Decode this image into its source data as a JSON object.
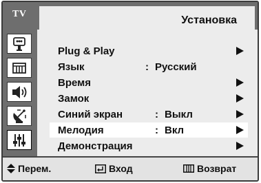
{
  "header": {
    "tv_label": "TV",
    "title": "Установка"
  },
  "sidebar": {
    "icons": [
      {
        "name": "picture-icon",
        "active": false
      },
      {
        "name": "channel-list-icon",
        "active": false
      },
      {
        "name": "sound-icon",
        "active": false
      },
      {
        "name": "antenna-icon",
        "active": false
      },
      {
        "name": "setup-sliders-icon",
        "active": true
      }
    ]
  },
  "menu": {
    "items": [
      {
        "label": "Plug & Play",
        "value": "",
        "has_arrow": true,
        "selected": false
      },
      {
        "label": "Язык",
        "value": "Русский",
        "has_arrow": false,
        "selected": false
      },
      {
        "label": "Время",
        "value": "",
        "has_arrow": true,
        "selected": false
      },
      {
        "label": "Замок",
        "value": "",
        "has_arrow": true,
        "selected": false
      },
      {
        "label": "Синий экран",
        "value": "Выкл",
        "has_arrow": true,
        "selected": false
      },
      {
        "label": "Мелодия",
        "value": "Вкл",
        "has_arrow": true,
        "selected": true
      },
      {
        "label": "Демонстрация",
        "value": "",
        "has_arrow": true,
        "selected": false
      }
    ]
  },
  "footer": {
    "move_label": "Перем.",
    "enter_label": "Вход",
    "return_label": "Возврат"
  },
  "colors": {
    "frame_gray": "#6e6e6e",
    "panel_light": "#ececec",
    "selected_row": "#ffffff",
    "text": "#111111"
  }
}
